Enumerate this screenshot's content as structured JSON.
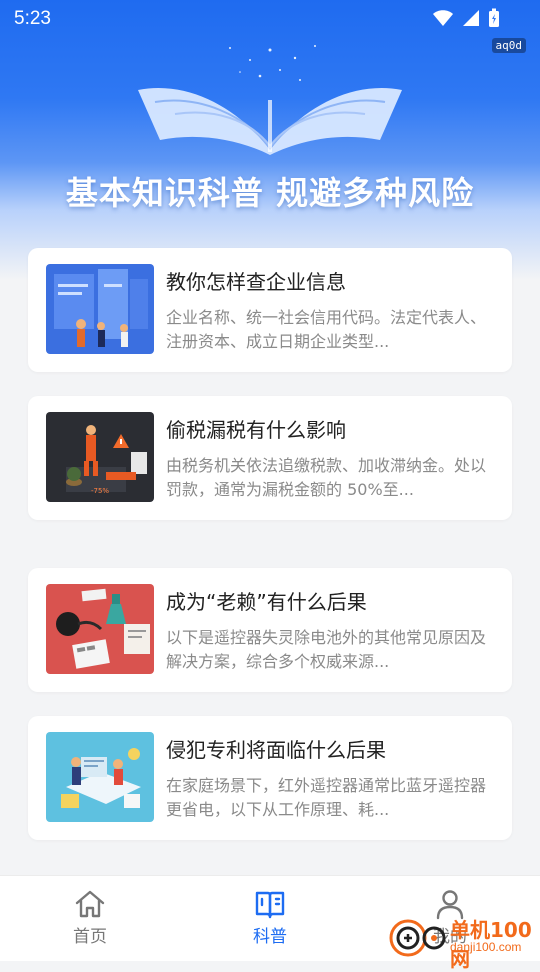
{
  "status_bar": {
    "time": "5:23",
    "badge": "aq0d"
  },
  "hero": {
    "title": "基本知识科普   规避多种风险"
  },
  "articles": [
    {
      "title": "教你怎样查企业信息",
      "desc": "企业名称、统一社会信用代码。法定代表人、注册资本、成立日期企业类型..."
    },
    {
      "title": "偷税漏税有什么影响",
      "desc": "由税务机关依法追缴税款、加收滞纳金。处以罚款，通常为漏税金额的 50%至..."
    },
    {
      "title": "成为“老赖”有什么后果",
      "desc": "以下是遥控器失灵除电池外的其他常见原因及解决方案，综合多个权威来源..."
    },
    {
      "title": "侵犯专利将面临什么后果",
      "desc": "在家庭场景下，红外遥控器通常比蓝牙遥控器更省电，以下从工作原理、耗..."
    }
  ],
  "tabs": [
    {
      "label": "首页",
      "icon": "home-icon"
    },
    {
      "label": "科普",
      "icon": "book-icon",
      "active": true
    },
    {
      "label": "我的",
      "icon": "user-icon"
    }
  ],
  "watermark": {
    "brand": "单机100网",
    "url": "danji100.com"
  },
  "colors": {
    "accent": "#1d6cf2",
    "hero_top": "#1f6bf0"
  }
}
